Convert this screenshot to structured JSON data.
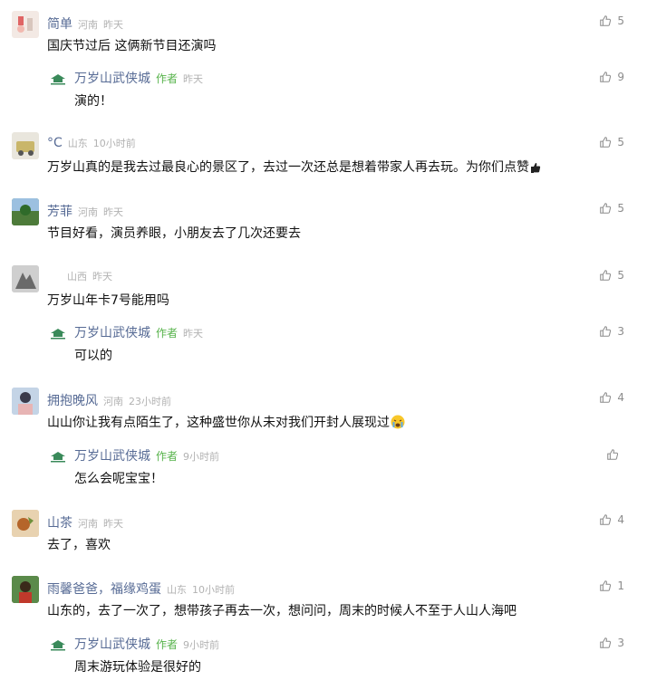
{
  "like_icon": "thumbs-up-icon",
  "colors": {
    "name": "#576b95",
    "meta": "#b2b2b2",
    "author_tag": "#57b34b",
    "like": "#8c8c8c"
  },
  "comments": [
    {
      "name": "简单",
      "location": "河南",
      "time": "昨天",
      "text": "国庆节过后 这俩新节目还演吗",
      "likes": "5",
      "reply": {
        "name": "万岁山武侠城",
        "tag": "作者",
        "time": "昨天",
        "text": "演的！",
        "likes": "9"
      }
    },
    {
      "name": "°C",
      "location": "山东",
      "time": "10小时前",
      "text": "万岁山真的是我去过最良心的景区了，去过一次还总是想着带家人再去玩。为你们点赞",
      "likes": "5"
    },
    {
      "name": "芳菲",
      "location": "河南",
      "time": "昨天",
      "text": "节目好看，演员养眼，小朋友去了几次还要去",
      "likes": "5"
    },
    {
      "name": "",
      "location": "山西",
      "time": "昨天",
      "text": "万岁山年卡7号能用吗",
      "likes": "5",
      "reply": {
        "name": "万岁山武侠城",
        "tag": "作者",
        "time": "昨天",
        "text": "可以的",
        "likes": "3"
      }
    },
    {
      "name": "拥抱晚风",
      "location": "河南",
      "time": "23小时前",
      "text": "山山你让我有点陌生了，这种盛世你从未对我们开封人展现过",
      "likes": "4",
      "reply": {
        "name": "万岁山武侠城",
        "tag": "作者",
        "time": "9小时前",
        "text": "怎么会呢宝宝！",
        "likes": ""
      }
    },
    {
      "name": "山茶",
      "location": "河南",
      "time": "昨天",
      "text": "去了，喜欢",
      "likes": "4"
    },
    {
      "name": "雨馨爸爸，福缘鸡蛋",
      "location": "山东",
      "time": "10小时前",
      "text": "山东的，去了一次了，想带孩子再去一次，想问问，周末的时候人不至于人山人海吧",
      "likes": "1",
      "reply": {
        "name": "万岁山武侠城",
        "tag": "作者",
        "time": "9小时前",
        "text": "周末游玩体验是很好的",
        "likes": "3"
      }
    }
  ]
}
